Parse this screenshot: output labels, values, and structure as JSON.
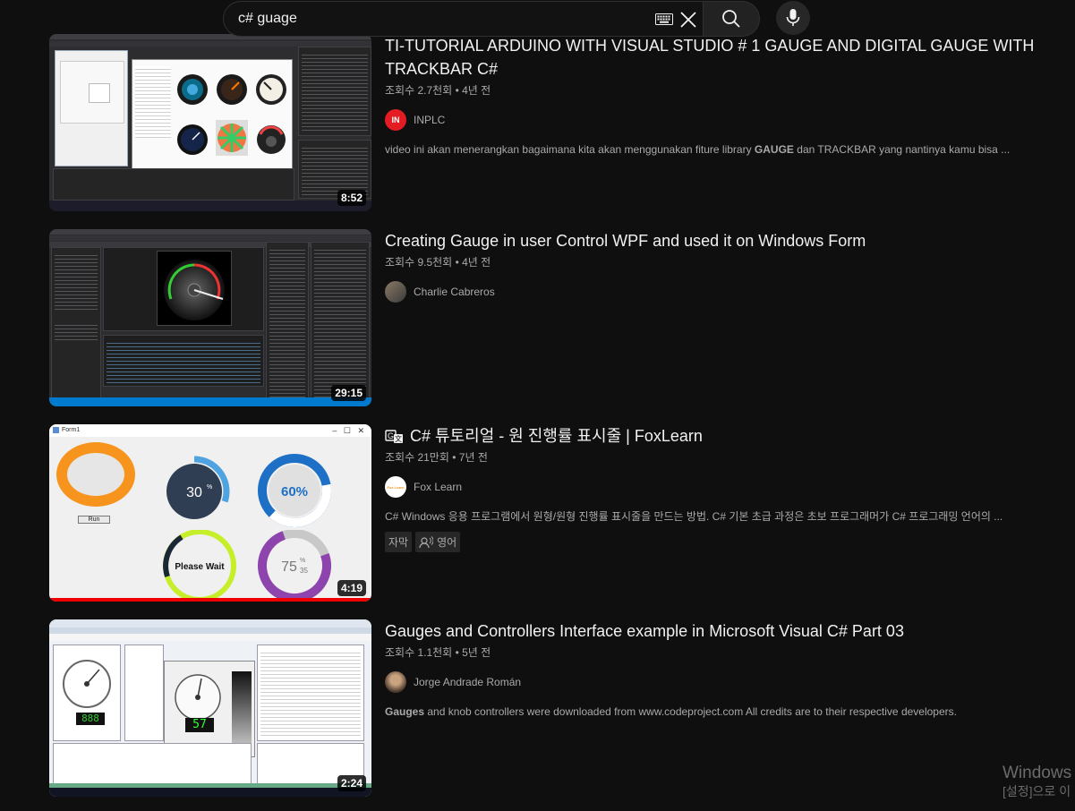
{
  "search": {
    "query": "c# guage"
  },
  "results": [
    {
      "title": "TI-TUTORIAL ARDUINO WITH VISUAL STUDIO # 1 GAUGE AND DIGITAL GAUGE WITH TRACKBAR C#",
      "views": "조회수 2.7천회",
      "age": "4년 전",
      "channel": "INPLC",
      "avatar_text": "IN",
      "description_pre": "video ini akan menerangkan bagaimana kita akan menggunakan fiture library ",
      "description_bold": "GAUGE",
      "description_post": " dan TRACKBAR yang nantinya kamu bisa ...",
      "duration": "8:52"
    },
    {
      "title": "Creating Gauge in user Control WPF and used it on Windows Form",
      "views": "조회수 9.5천회",
      "age": "4년 전",
      "channel": "Charlie Cabreros",
      "duration": "29:15"
    },
    {
      "title": "C# 튜토리얼 - 원 진행률 표시줄 | FoxLearn",
      "views": "조회수 21만회",
      "age": "7년 전",
      "channel": "Fox Learn",
      "avatar_text": "Fox Learn",
      "description": "C# Windows 응용 프로그램에서 원형/원형 진행률 표시줄을 만드는 방법. C# 기본 초급 과정은 초보 프로그래머가 C# 프로그래밍 언어의 ...",
      "badge_subtitles": "자막",
      "badge_language": "영어",
      "duration": "4:19",
      "thumb": {
        "window_title": "Form1",
        "run_label": "Run",
        "gauge_30": "30",
        "gauge_30_unit": "%",
        "gauge_60": "60%",
        "please_wait": "Please Wait",
        "gauge_75": "75",
        "gauge_75_unit": "%",
        "gauge_75_sub": "35"
      }
    },
    {
      "title": "Gauges and Controllers Interface example in Microsoft Visual C# Part 03",
      "views": "조회수 1.1천회",
      "age": "5년 전",
      "channel": "Jorge Andrade Román",
      "description_bold": "Gauges",
      "description_post": " and knob controllers were downloaded from www.codeproject.com All credits are to their respective developers.",
      "duration": "2:24",
      "thumb": {
        "digital_left": "888",
        "digital_center": "57"
      }
    }
  ],
  "meta_separator": "•",
  "watermark": {
    "line1": "Windows",
    "line2": "[설정]으로 이"
  },
  "colors": {
    "background": "#0f0f0f",
    "text_primary": "#f1f1f1",
    "text_secondary": "#aaaaaa",
    "orange": "#f7941d",
    "blue": "#1e6fc6"
  }
}
